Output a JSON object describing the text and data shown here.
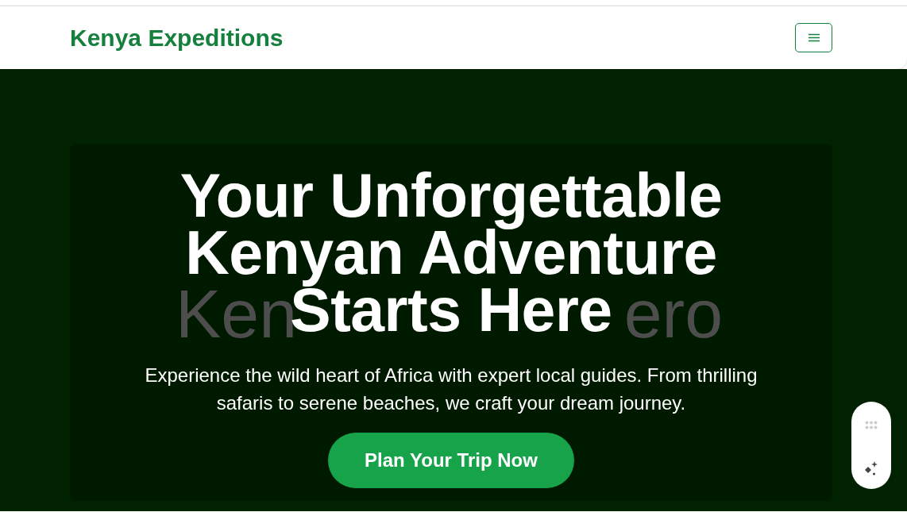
{
  "header": {
    "brand": "Kenya Expeditions"
  },
  "hero": {
    "image_alt_visible": [
      "Ken",
      "ero"
    ],
    "heading_lines": [
      "Your Unforgettable",
      "Kenyan Adventure",
      "Starts Here"
    ],
    "text": "Experience the wild heart of Africa with expert local guides. From thrilling safaris to serene beaches, we craft your dream journey.",
    "button": "Plan Your Trip Now"
  }
}
